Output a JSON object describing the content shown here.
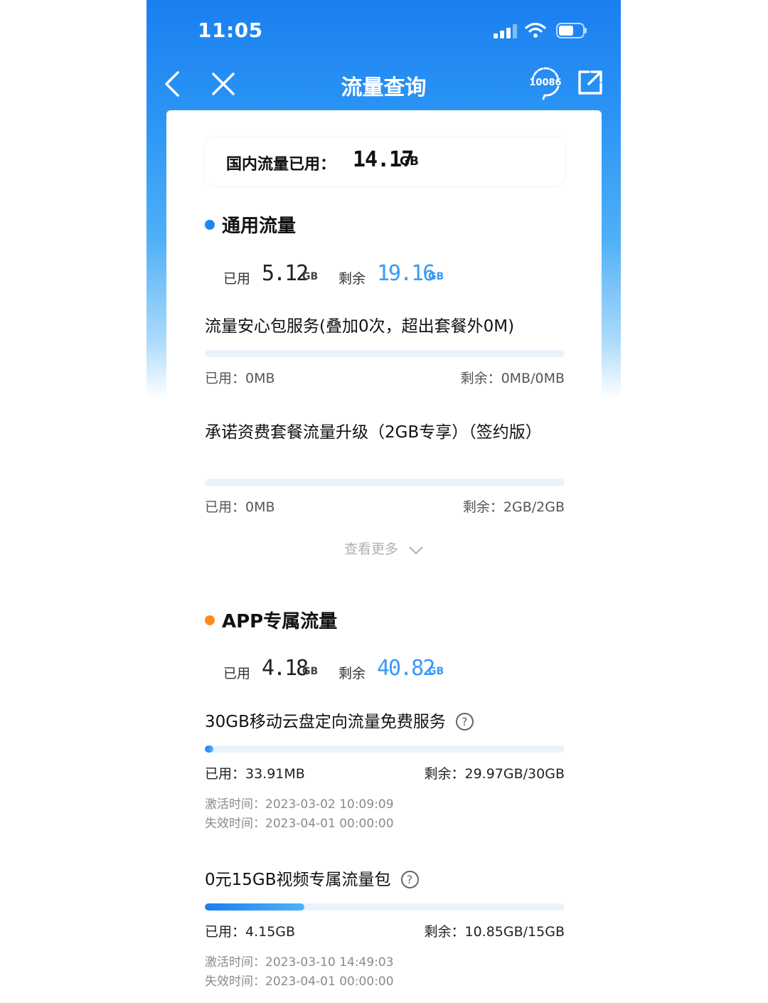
{
  "status_bar": {
    "time": "11:05"
  },
  "nav": {
    "title": "流量查询",
    "service_label": "10086"
  },
  "total": {
    "label": "国内流量已用：",
    "value": "14.17",
    "unit": "GB"
  },
  "general": {
    "title": "通用流量",
    "dot_color": "#1e88f0",
    "used_label": "已用",
    "used_value": "5.12",
    "used_unit": "GB",
    "remain_label": "剩余",
    "remain_value": "19.16",
    "remain_unit": "GB",
    "packages": [
      {
        "name": "流量安心包服务(叠加0次，超出套餐外0M)",
        "used": "已用：0MB",
        "remain": "剩余：0MB/0MB",
        "progress": 0
      },
      {
        "name": "承诺资费套餐流量升级（2GB专享）（签约版）",
        "used": "已用：0MB",
        "remain": "剩余：2GB/2GB",
        "progress": 0
      }
    ],
    "more_label": "查看更多"
  },
  "app": {
    "title": "APP专属流量",
    "dot_color": "#ff8c1a",
    "used_label": "已用",
    "used_value": "4.18",
    "used_unit": "GB",
    "remain_label": "剩余",
    "remain_value": "40.82",
    "remain_unit": "GB",
    "packages": [
      {
        "name": "30GB移动云盘定向流量免费服务",
        "used": "已用：33.91MB",
        "remain": "剩余：29.97GB/30GB",
        "activate": "激活时间：2023-03-02 10:09:09",
        "expire": "失效时间：2023-04-01 00:00:00",
        "progress": 0.0011
      },
      {
        "name": "0元15GB视频专属流量包",
        "used": "已用：4.15GB",
        "remain": "剩余：10.85GB/15GB",
        "activate": "激活时间：2023-03-10 14:49:03",
        "expire": "失效时间：2023-04-01 00:00:00",
        "progress": 0.277
      }
    ]
  },
  "colors": {
    "brand_blue": "#1a7ff0",
    "value_blue": "#3a9af5",
    "orange": "#ff8c1a"
  }
}
